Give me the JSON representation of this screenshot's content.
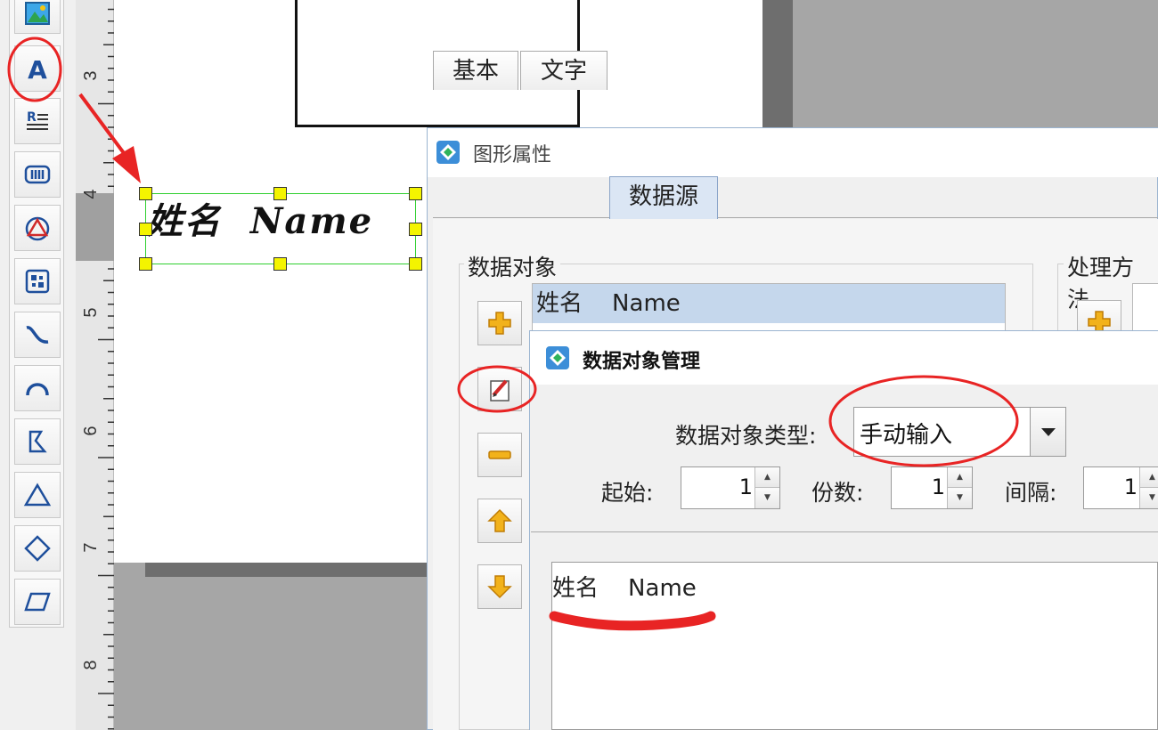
{
  "canvas": {
    "ruler_labels": [
      "3",
      "4",
      "5",
      "6",
      "7",
      "8"
    ],
    "label_object_text": "姓名  Name"
  },
  "toolbar": {
    "tools": [
      {
        "name": "image-tool",
        "icon": "image-icon"
      },
      {
        "name": "text-tool",
        "icon": "letter-a-icon"
      },
      {
        "name": "rich-text-tool",
        "icon": "rich-text-icon"
      },
      {
        "name": "barcode-tool",
        "icon": "barcode-icon"
      },
      {
        "name": "shape-tool",
        "icon": "triangle-circle-icon"
      },
      {
        "name": "qrcode-tool",
        "icon": "qrcode-icon"
      },
      {
        "name": "curve-tool",
        "icon": "curve-icon"
      },
      {
        "name": "arc-tool",
        "icon": "arc-icon"
      },
      {
        "name": "polygon-tool",
        "icon": "polygon-icon"
      },
      {
        "name": "triangle-tool",
        "icon": "triangle-icon"
      },
      {
        "name": "diamond-tool",
        "icon": "diamond-icon"
      },
      {
        "name": "parallelogram-tool",
        "icon": "parallelogram-icon"
      }
    ]
  },
  "properties_dialog": {
    "title": "图形属性",
    "tabs": [
      {
        "label": "基本"
      },
      {
        "label": "文字"
      },
      {
        "label": "数据源",
        "active": true
      }
    ],
    "data_objects_group": "数据对象",
    "processing_group": "处理方法",
    "data_object_list": [
      "姓名    Name"
    ],
    "side_buttons": [
      "add-icon",
      "edit-icon",
      "remove-icon",
      "move-up-icon",
      "move-down-icon"
    ]
  },
  "data_object_dialog": {
    "title": "数据对象管理",
    "type_label": "数据对象类型:",
    "type_value": "手动输入",
    "start_label": "起始:",
    "start_value": "1",
    "copies_label": "份数:",
    "copies_value": "1",
    "interval_label": "间隔:",
    "interval_value": "1",
    "content": "姓名    Name"
  },
  "colors": {
    "annotation_red": "#e82424",
    "handle_yellow": "#f4f400",
    "selection_green": "#2fcf2f",
    "active_tab": "#dbe6f4",
    "list_selection": "#c5d7ec"
  }
}
